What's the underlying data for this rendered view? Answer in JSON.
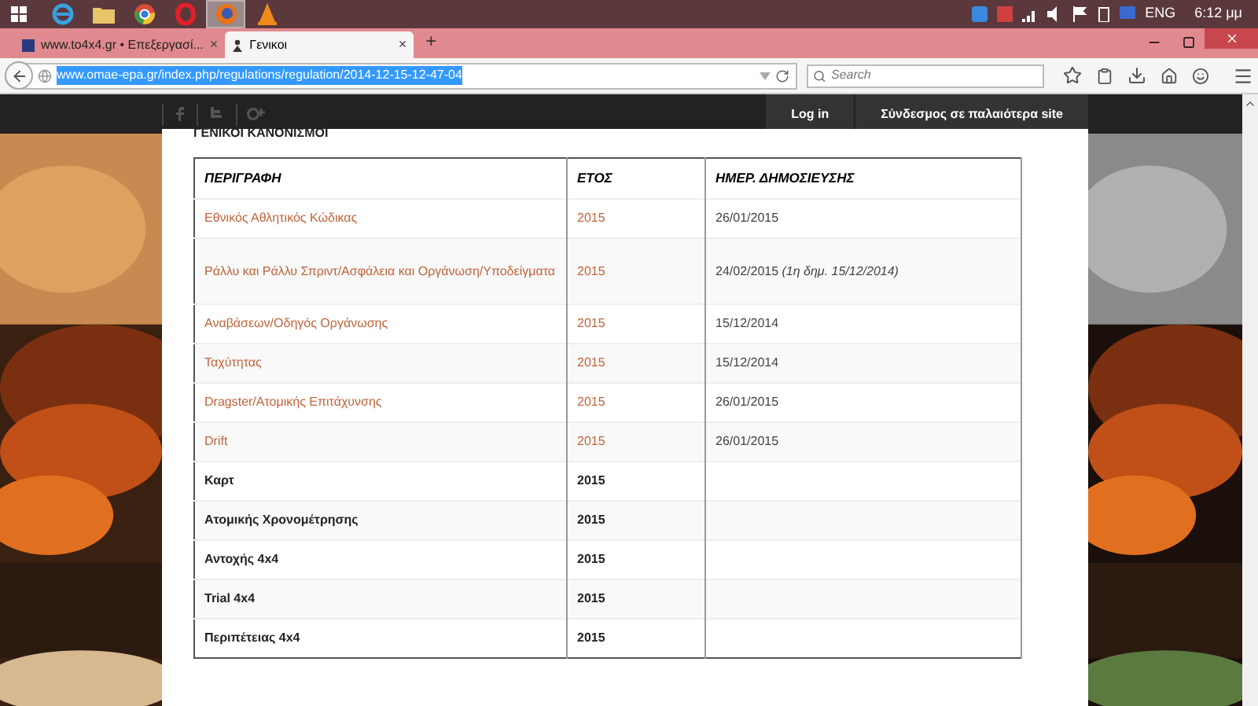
{
  "taskbar": {
    "apps": [
      {
        "kind": "ie",
        "selected": false
      },
      {
        "kind": "folder",
        "selected": false
      },
      {
        "kind": "chrome",
        "selected": false
      },
      {
        "kind": "opera",
        "selected": false
      },
      {
        "kind": "firefox",
        "selected": true
      },
      {
        "kind": "vlc",
        "selected": false
      }
    ],
    "language": "ENG",
    "time": "6:12 μμ"
  },
  "tabs": [
    {
      "title": "www.to4x4.gr • Επεξεργασί...",
      "selected": false,
      "close": "×"
    },
    {
      "title": "Γενικοι",
      "selected": true,
      "close": "×"
    }
  ],
  "new_tab": "+",
  "address": "www.omae-epa.gr/index.php/regulations/regulation/2014-12-15-12-47-04",
  "search": {
    "placeholder": "Search"
  },
  "site_nav": {
    "links": [
      "Log in",
      "Σύνδεσμος σε παλαιότερα site"
    ]
  },
  "heading": "ΓΕΝΙΚΟΙ ΚΑΝΟΝΙΣΜΟΙ",
  "table": {
    "columns": [
      "ΠΕΡΙΓΡΑΦΗ",
      "ΕΤΟΣ",
      "ΗΜΕΡ. ΔΗΜΟΣΙΕΥΣΗΣ"
    ],
    "rows": [
      {
        "kind": "link",
        "cells": [
          "Εθνικός Αθλητικός Κώδικας",
          "2015",
          "26/01/2015"
        ]
      },
      {
        "kind": "link",
        "cells": [
          "Ράλλυ και Ράλλυ Σπριντ/Ασφάλεια και Οργάνωση/Υποδείγματα",
          "2015",
          "24/02/2015 *(1η δημ. 15/12/2014)*"
        ]
      },
      {
        "kind": "link",
        "cells": [
          "Αναβάσεων/Οδηγός Οργάνωσης",
          "2015",
          "15/12/2014"
        ]
      },
      {
        "kind": "link",
        "cells": [
          "Ταχύτητας",
          "2015",
          "15/12/2014"
        ]
      },
      {
        "kind": "link",
        "cells": [
          "Dragster/Ατομικής Επιτάχυνσης",
          "2015",
          "26/01/2015"
        ]
      },
      {
        "kind": "link",
        "cells": [
          "Drift",
          "2015",
          "26/01/2015"
        ]
      },
      {
        "kind": "plain",
        "cells": [
          "Καρτ",
          "2015"
        ]
      },
      {
        "kind": "plain",
        "cells": [
          "Ατομικής Χρονομέτρησης",
          "2015"
        ]
      },
      {
        "kind": "plain",
        "cells": [
          "Αντοχής 4x4",
          "2015"
        ]
      },
      {
        "kind": "plain",
        "cells": [
          "Trial 4x4",
          "2015"
        ]
      },
      {
        "kind": "plain",
        "cells": [
          "Περιπέτειας 4x4",
          "2015"
        ]
      }
    ]
  }
}
